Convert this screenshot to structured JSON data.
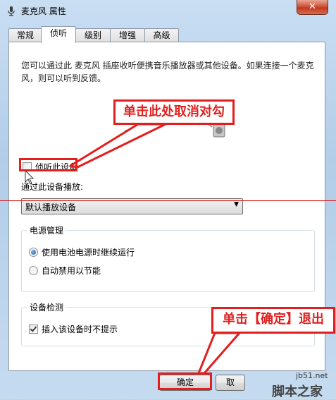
{
  "window": {
    "title": "麦克风 属性",
    "close_glyph": "✕"
  },
  "tabs": [
    {
      "label": "常规"
    },
    {
      "label": "侦听",
      "active": true
    },
    {
      "label": "级别"
    },
    {
      "label": "增强"
    },
    {
      "label": "高级"
    }
  ],
  "listen": {
    "description": "您可以通过此 麦克风 插座收听便携音乐播放器或其他设备。如果连接一个麦克风，则可以听到反馈。",
    "listen_checkbox": {
      "label": "侦听此设备",
      "checked": false
    },
    "playback_label": "通过此设备播放:",
    "playback_select": {
      "value": "默认播放设备"
    }
  },
  "power": {
    "title": "电源管理",
    "options": [
      {
        "label": "使用电池电源时继续运行",
        "selected": true
      },
      {
        "label": "自动禁用以节能",
        "selected": false
      }
    ]
  },
  "detection": {
    "title": "设备检测",
    "checkbox": {
      "label": "插入该设备时不提示",
      "checked": true
    }
  },
  "buttons": {
    "ok": "确定",
    "cancel": "取"
  },
  "annotations": {
    "callout_uncheck": "单击此处取消对勾",
    "callout_ok": "单击【确定】退出",
    "color": "#e21e1e"
  },
  "watermark": {
    "site": "jb51.net",
    "brand": "脚本之家"
  }
}
